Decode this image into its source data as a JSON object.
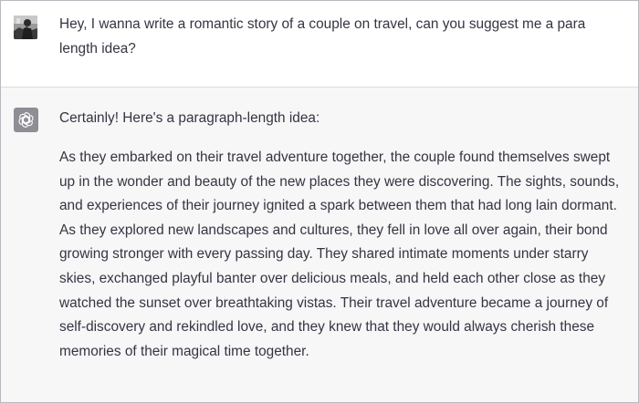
{
  "conversation": {
    "user_message": {
      "avatar_icon": "user-photo-avatar-icon",
      "text": "Hey, I wanna write a romantic story of a couple on travel, can you suggest me a para length idea?"
    },
    "assistant_message": {
      "avatar_icon": "chatgpt-logo-icon",
      "avatar_color": "#8e8e95",
      "intro": "Certainly! Here's a paragraph-length idea:",
      "body": "As they embarked on their travel adventure together, the couple found themselves swept up in the wonder and beauty of the new places they were discovering. The sights, sounds, and experiences of their journey ignited a spark between them that had long lain dormant. As they explored new landscapes and cultures, they fell in love all over again, their bond growing stronger with every passing day. They shared intimate moments under starry skies, exchanged playful banter over delicious meals, and held each other close as they watched the sunset over breathtaking vistas. Their travel adventure became a journey of self-discovery and rekindled love, and they knew that they would always cherish these memories of their magical time together."
    }
  }
}
